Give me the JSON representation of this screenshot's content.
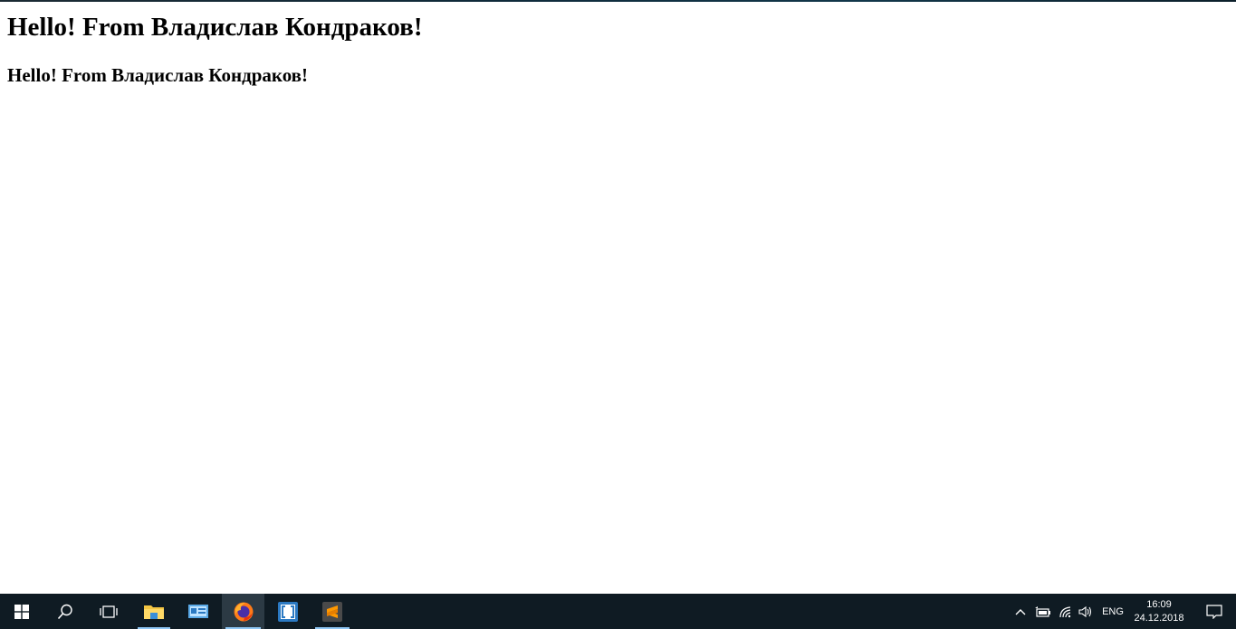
{
  "page": {
    "heading1": "Hello! From Владислав Кондраков!",
    "heading2": "Hello! From Владислав Кондраков!"
  },
  "taskbar": {
    "apps": [
      {
        "icon": "file-explorer-icon"
      },
      {
        "icon": "control-panel-icon"
      },
      {
        "icon": "firefox-icon",
        "active": true
      },
      {
        "icon": "brackets-icon"
      },
      {
        "icon": "sublime-text-icon"
      }
    ],
    "tray": {
      "language": "ENG",
      "time": "16:09",
      "date": "24.12.2018"
    }
  },
  "colors": {
    "taskbar_bg": "#0f1b23",
    "active_app_bg": "#2c3a44",
    "accent_underline": "#8fc7f5"
  }
}
